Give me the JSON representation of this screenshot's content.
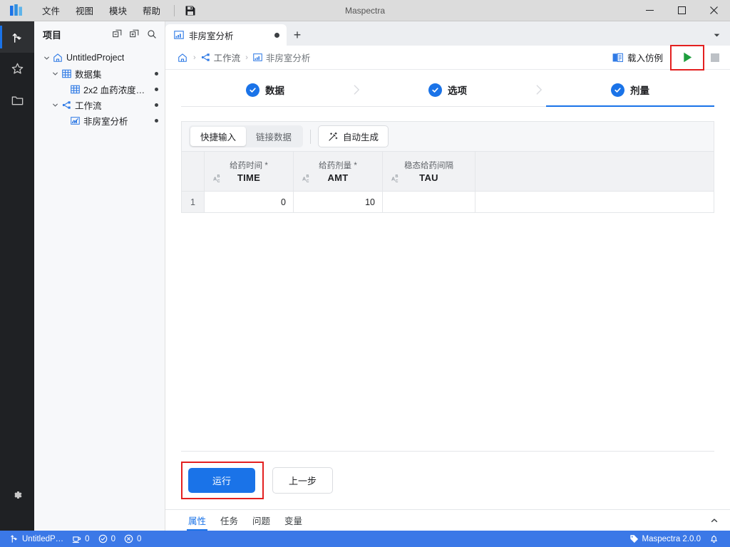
{
  "window": {
    "title": "Maspectra",
    "minimize_label": "最小化",
    "maximize_label": "最大化",
    "close_label": "关闭"
  },
  "menubar": {
    "logo": "maspectra-logo",
    "items": [
      {
        "label": "文件",
        "name": "menu-file"
      },
      {
        "label": "视图",
        "name": "menu-view"
      },
      {
        "label": "模块",
        "name": "menu-module"
      },
      {
        "label": "帮助",
        "name": "menu-help"
      }
    ],
    "save_icon": "save-icon"
  },
  "rail": {
    "items": [
      {
        "name": "rail-item-workflow",
        "icon": "branch-icon",
        "active": true
      },
      {
        "name": "rail-item-favorites",
        "icon": "star-icon",
        "active": false
      },
      {
        "name": "rail-item-files",
        "icon": "folder-icon",
        "active": false
      }
    ],
    "settings": {
      "name": "rail-item-settings",
      "icon": "gear-icon"
    }
  },
  "panel": {
    "title": "项目",
    "actions": [
      {
        "name": "collapse-all-button",
        "icon": "collapse-all-icon"
      },
      {
        "name": "expand-all-button",
        "icon": "expand-all-icon"
      },
      {
        "name": "search-button",
        "icon": "search-icon"
      }
    ],
    "tree": [
      {
        "label": "UntitledProject",
        "icon": "home-icon",
        "depth": 0,
        "expanded": true,
        "dot": false
      },
      {
        "label": "数据集",
        "icon": "table-icon",
        "depth": 1,
        "expanded": true,
        "dot": true
      },
      {
        "label": "2x2 血药浓度…",
        "icon": "table-icon",
        "depth": 2,
        "expanded": null,
        "dot": true
      },
      {
        "label": "工作流",
        "icon": "workflow-icon",
        "depth": 1,
        "expanded": true,
        "dot": true
      },
      {
        "label": "非房室分析",
        "icon": "chart-icon",
        "depth": 2,
        "expanded": null,
        "dot": true
      }
    ]
  },
  "tabstrip": {
    "tabs": [
      {
        "label": "非房室分析",
        "icon": "chart-icon",
        "modified": true,
        "active": true
      }
    ],
    "add_tab_label": "+",
    "overflow_icon": "chevron-down-icon"
  },
  "breadcrumb": {
    "home_icon": "home-icon",
    "items": [
      {
        "label": "工作流",
        "icon": "workflow-icon"
      },
      {
        "label": "非房室分析",
        "icon": "chart-icon"
      }
    ],
    "separator": "›"
  },
  "toolbar_right": {
    "load_demo_label": "载入仿例",
    "load_demo_icon": "book-icon",
    "run_icon": "play-icon",
    "run_label": "运行",
    "stop_icon": "stop-icon",
    "stop_label": "停止",
    "run_highlight": true
  },
  "stepper": {
    "steps": [
      {
        "label": "数据",
        "done": true,
        "active": false
      },
      {
        "label": "选项",
        "done": true,
        "active": false
      },
      {
        "label": "剂量",
        "done": true,
        "active": true
      }
    ],
    "separator_icon": "chevron-right-icon"
  },
  "dose": {
    "toolbar": {
      "segments": [
        {
          "label": "快捷输入",
          "selected": true
        },
        {
          "label": "链接数据",
          "selected": false
        }
      ],
      "auto_generate_label": "自动生成",
      "auto_generate_icon": "magic-wand-icon"
    },
    "table": {
      "index_header": "",
      "columns": [
        {
          "title": "给药时间",
          "required": true,
          "code": "TIME",
          "type_icon": "abc-icon"
        },
        {
          "title": "给药剂量",
          "required": true,
          "code": "AMT",
          "type_icon": "abc-icon"
        },
        {
          "title": "稳态给药间隔",
          "required": false,
          "code": "TAU",
          "type_icon": "abc-icon"
        }
      ],
      "rows": [
        {
          "index": "1",
          "cells": [
            "0",
            "10",
            ""
          ]
        }
      ]
    }
  },
  "footer": {
    "run_button_label": "运行",
    "prev_button_label": "上一步",
    "run_highlight": true
  },
  "bottom_tabs": {
    "tabs": [
      {
        "label": "属性",
        "active": true
      },
      {
        "label": "任务",
        "active": false
      },
      {
        "label": "问题",
        "active": false
      },
      {
        "label": "变量",
        "active": false
      }
    ],
    "collapse_icon": "chevron-up-icon"
  },
  "statusbar": {
    "project_icon": "branch-icon",
    "project_label": "UntitledP…",
    "counters": [
      {
        "icon": "cup-icon",
        "value": "0",
        "name": "status-tasks-count"
      },
      {
        "icon": "check-circle-icon",
        "value": "0",
        "name": "status-success-count"
      },
      {
        "icon": "error-circle-icon",
        "value": "0",
        "name": "status-error-count"
      }
    ],
    "version_icon": "tag-icon",
    "version_label": "Maspectra 2.0.0",
    "notification_icon": "bell-icon"
  },
  "colors": {
    "accent": "#1a73e8",
    "statusbar": "#3b78e7",
    "highlight": "#e32020",
    "rail": "#1f2124"
  }
}
